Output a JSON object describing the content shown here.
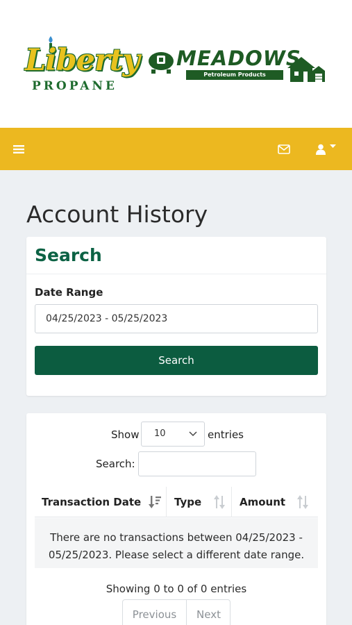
{
  "brand": {
    "liberty_word": "Liberty",
    "liberty_sub": "PROPANE",
    "meadows_word": "MEADOWS",
    "meadows_sub": "Petroleum Products"
  },
  "navbar": {
    "color": "#ecb820",
    "icons": [
      "menu-icon",
      "envelope-icon",
      "user-icon",
      "caret-down-icon"
    ]
  },
  "page": {
    "title": "Account History"
  },
  "search_card": {
    "title": "Search",
    "date_label": "Date Range",
    "date_value": "04/25/2023 - 05/25/2023",
    "button_label": "Search",
    "accent": "#0c5c40"
  },
  "table": {
    "show_label": "Show",
    "entries_value": "10",
    "entries_label": "entries",
    "search_label": "Search:",
    "columns": [
      "Transaction Date",
      "Type",
      "Amount"
    ],
    "empty_message": "There are no transactions between 04/25/2023 - 05/25/2023. Please select a different date range.",
    "info": "Showing 0 to 0 of 0 entries",
    "prev_label": "Previous",
    "next_label": "Next"
  }
}
